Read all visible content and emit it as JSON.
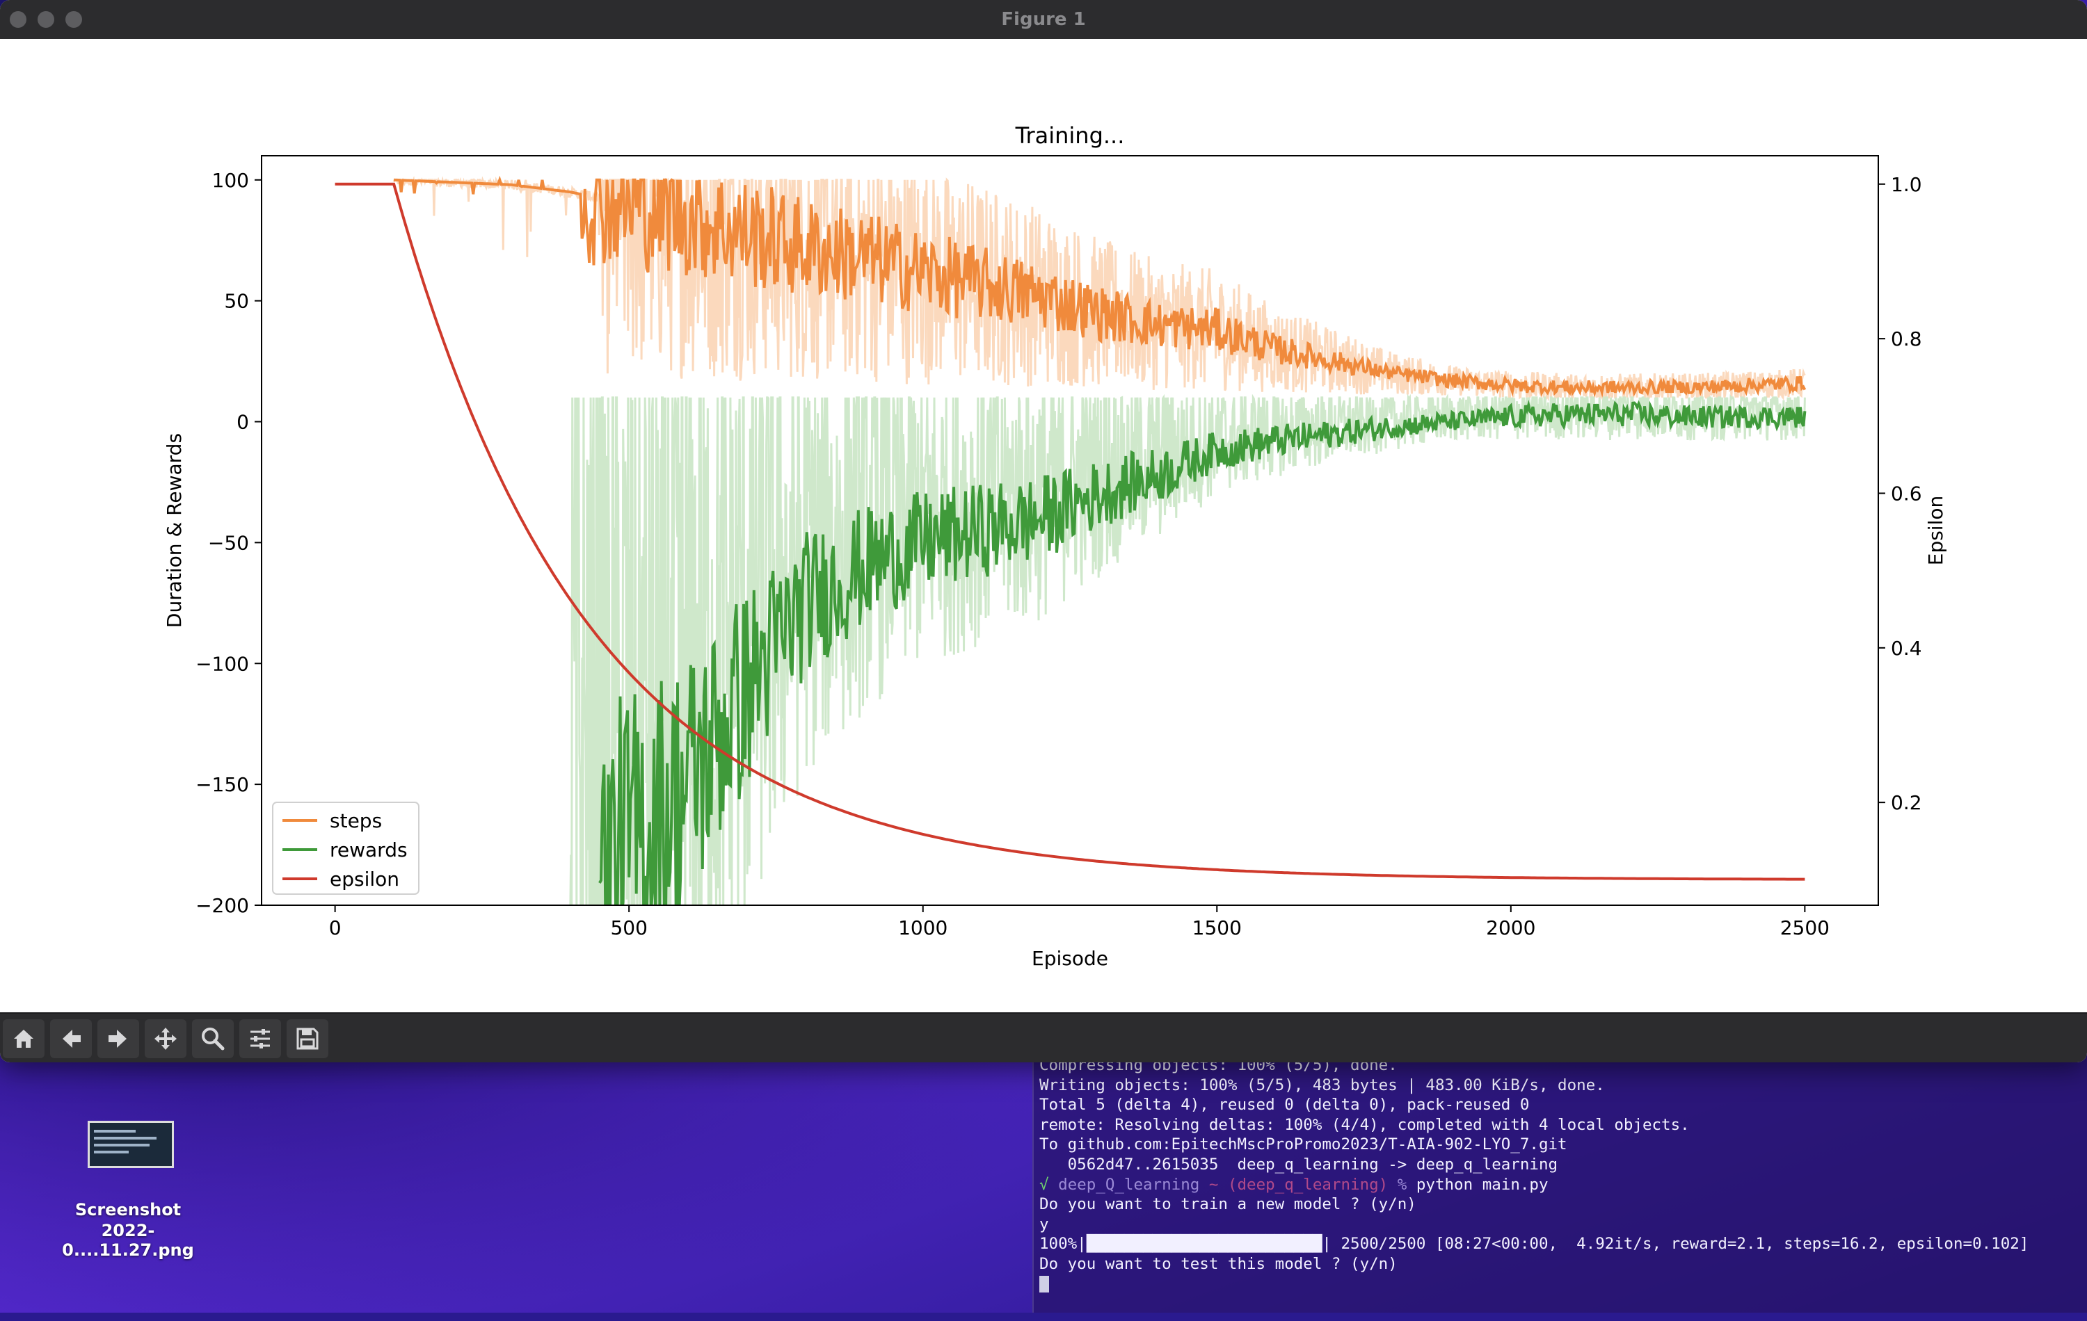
{
  "window": {
    "title": "Figure 1"
  },
  "toolbar": {
    "buttons": [
      "home-icon",
      "back-arrow-icon",
      "forward-arrow-icon",
      "pan-icon",
      "zoom-icon",
      "configure-subplots-icon",
      "save-icon"
    ]
  },
  "colors": {
    "steps": "#f08a3c",
    "steps_light": "#fbd9bd",
    "rewards": "#3f9a3a",
    "rewards_light": "#cfe8cb",
    "epsilon": "#cf3a2c"
  },
  "chart_data": {
    "type": "line",
    "title": "Training...",
    "xlabel": "Episode",
    "ylabel": "Duration & Rewards",
    "y2label": "Epsilon",
    "xlim": [
      -125,
      2625
    ],
    "ylim": [
      -200,
      110
    ],
    "y2lim": [
      0.067,
      1.0367
    ],
    "xticks": [
      0,
      500,
      1000,
      1500,
      2000,
      2500
    ],
    "yticks": [
      100,
      50,
      0,
      -50,
      -100,
      -150,
      -200
    ],
    "y2ticks": [
      1.0,
      0.8,
      0.6,
      0.4,
      0.2
    ],
    "ytick_labels": [
      "100",
      "50",
      "0",
      "−50",
      "−100",
      "−150",
      "−200"
    ],
    "y2tick_labels": [
      "1.0",
      "0.8",
      "0.6",
      "0.4",
      "0.2"
    ],
    "legend_position": "lower-left",
    "series": [
      {
        "name": "steps",
        "axis": "left",
        "x": [
          0,
          100,
          200,
          300,
          400,
          500,
          600,
          700,
          800,
          900,
          1000,
          1100,
          1200,
          1300,
          1400,
          1500,
          1600,
          1700,
          1800,
          1900,
          2000,
          2100,
          2200,
          2300,
          2400,
          2500
        ],
        "values": [
          null,
          100,
          99,
          98,
          95,
          90,
          85,
          78,
          72,
          68,
          62,
          57,
          52,
          45,
          40,
          38,
          30,
          25,
          20,
          17,
          15,
          14,
          14,
          14,
          15,
          16
        ]
      },
      {
        "name": "rewards",
        "axis": "left",
        "x": [
          450,
          500,
          600,
          700,
          800,
          900,
          1000,
          1100,
          1200,
          1300,
          1400,
          1500,
          1600,
          1700,
          1800,
          1900,
          2000,
          2100,
          2200,
          2300,
          2400,
          2500
        ],
        "values": [
          -190,
          -175,
          -150,
          -110,
          -75,
          -60,
          -50,
          -45,
          -40,
          -30,
          -22,
          -12,
          -8,
          -5,
          -2,
          0,
          2,
          3,
          3,
          2,
          2,
          2
        ]
      },
      {
        "name": "epsilon",
        "axis": "right",
        "x": [
          0,
          100,
          200,
          300,
          400,
          500,
          600,
          700,
          800,
          900,
          1000,
          1100,
          1200,
          1300,
          1400,
          1500,
          1600,
          1700,
          1800,
          1900,
          2000,
          2100,
          2200,
          2300,
          2400,
          2500
        ],
        "values": [
          1.0,
          1.0,
          0.81,
          0.66,
          0.54,
          0.44,
          0.37,
          0.31,
          0.265,
          0.23,
          0.2,
          0.18,
          0.163,
          0.15,
          0.14,
          0.132,
          0.126,
          0.121,
          0.117,
          0.114,
          0.112,
          0.11,
          0.108,
          0.106,
          0.104,
          0.103
        ]
      }
    ]
  },
  "terminal": {
    "lines": [
      "Compressing objects: 100% (5/5), done.",
      "Writing objects: 100% (5/5), 483 bytes | 483.00 KiB/s, done.",
      "Total 5 (delta 4), reused 0 (delta 0), pack-reused 0",
      "remote: Resolving deltas: 100% (4/4), completed with 4 local objects.",
      "To github.com:EpitechMscProPromo2023/T-AIA-902-LYO_7.git",
      "   0562d47..2615035  deep_q_learning -> deep_q_learning"
    ],
    "prompt_check": "√",
    "prompt_dir": "deep_Q_learning",
    "prompt_branch": "~ (deep_q_learning)",
    "prompt_symbol": "%",
    "command": "python main.py",
    "after_lines": [
      "Do you want to train a new model ? (y/n)",
      "y",
      "100%|█████████████████████████| 2500/2500 [08:27<00:00,  4.92it/s, reward=2.1, steps=16.2, epsilon=0.102]",
      "Do you want to test this model ? (y/n)"
    ]
  },
  "desktop_icon": {
    "label_line1": "Screenshot",
    "label_line2": "2022-0....11.27.png"
  }
}
